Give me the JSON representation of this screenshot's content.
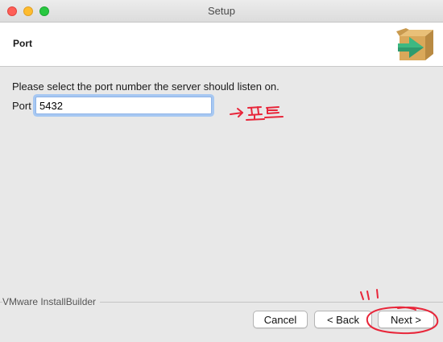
{
  "window": {
    "title": "Setup"
  },
  "header": {
    "page_title": "Port"
  },
  "main": {
    "prompt": "Please select the port number the server should listen on.",
    "port_label": "Port",
    "port_value": "5432"
  },
  "footer": {
    "vendor": "VMware InstallBuilder",
    "cancel_label": "Cancel",
    "back_label": "< Back",
    "next_label": "Next >"
  },
  "annotations": {
    "port_note": "포트",
    "color": "#e8263a"
  },
  "icons": {
    "logo": "install-box-arrow-icon"
  },
  "colors": {
    "logo_box": "#d9a85a",
    "logo_arrow": "#2e9b6e",
    "focus_ring": "#a7c8f2"
  }
}
